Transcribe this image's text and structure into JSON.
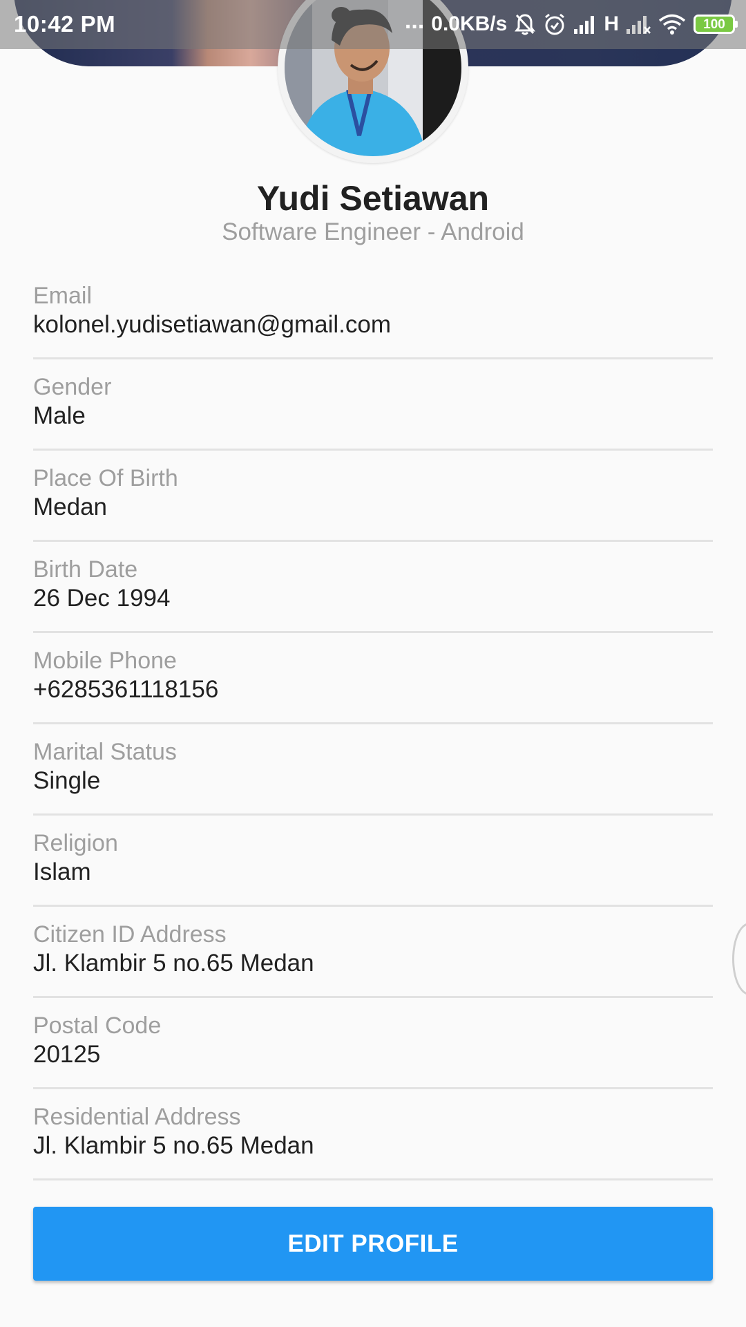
{
  "status_bar": {
    "time": "10:42 PM",
    "more_indicator": "...",
    "network_speed": "0.0KB/s",
    "network_type": "H",
    "battery_level": "100",
    "icons": [
      "notifications-off-icon",
      "alarm-icon",
      "signal-icon",
      "no-signal-icon",
      "wifi-icon",
      "battery-icon"
    ]
  },
  "profile": {
    "name": "Yudi Setiawan",
    "role": "Software Engineer - Android"
  },
  "fields": [
    {
      "label": "Email",
      "value": "kolonel.yudisetiawan@gmail.com"
    },
    {
      "label": "Gender",
      "value": "Male"
    },
    {
      "label": "Place Of Birth",
      "value": "Medan"
    },
    {
      "label": "Birth Date",
      "value": "26 Dec 1994"
    },
    {
      "label": "Mobile Phone",
      "value": "+6285361118156"
    },
    {
      "label": "Marital Status",
      "value": "Single"
    },
    {
      "label": "Religion",
      "value": "Islam"
    },
    {
      "label": "Citizen ID Address",
      "value": "Jl. Klambir 5 no.65 Medan"
    },
    {
      "label": "Postal Code",
      "value": "20125"
    },
    {
      "label": "Residential Address",
      "value": "Jl. Klambir 5 no.65 Medan"
    }
  ],
  "actions": {
    "edit_profile_label": "EDIT PROFILE"
  },
  "colors": {
    "primary_button": "#2196f3",
    "label_gray": "#9e9e9e",
    "value_text": "#212121",
    "divider": "#e2e2e2",
    "background": "#fafafa"
  }
}
